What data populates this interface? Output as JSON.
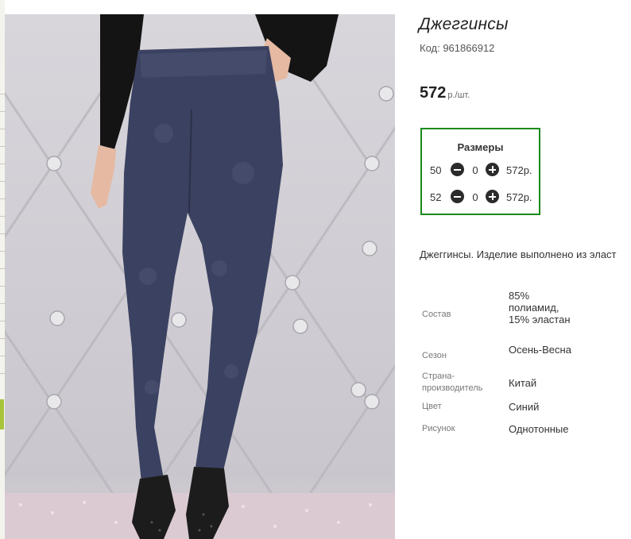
{
  "product": {
    "title": "Джеггинсы",
    "code_label": "Код: 961866912",
    "price_value": "572",
    "price_unit": "р./шт."
  },
  "sizes": {
    "title": "Размеры",
    "rows": [
      {
        "size": "50",
        "qty": "0",
        "price": "572р."
      },
      {
        "size": "52",
        "qty": "0",
        "price": "572р."
      }
    ]
  },
  "description": "Джеггинсы. Изделие выполнено из эласт",
  "properties": [
    {
      "label": "Состав",
      "value": "85% полиамид, 15% эластан"
    },
    {
      "label": "Сезон",
      "value": "Осень-Весна"
    },
    {
      "label": "Страна-производитель",
      "value": "Китай"
    },
    {
      "label": "Цвет",
      "value": "Синий"
    },
    {
      "label": "Рисунок",
      "value": "Однотонные"
    }
  ],
  "icons": {
    "minus": "minus-circle-icon",
    "plus": "plus-circle-icon"
  },
  "colors": {
    "sizes_border": "#1a8a1a",
    "denim": "#3b4160"
  }
}
